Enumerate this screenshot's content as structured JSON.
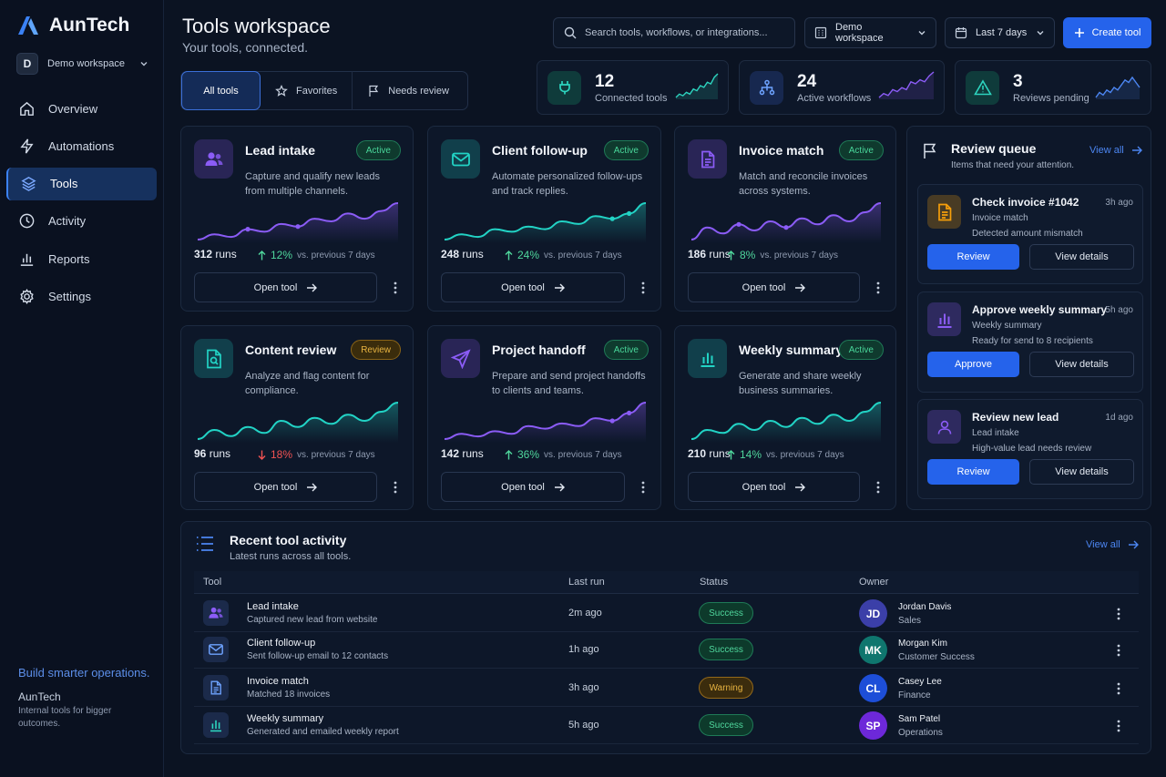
{
  "brand": {
    "name": "AunTech"
  },
  "workspace": {
    "initial": "D",
    "name": "Demo workspace"
  },
  "nav": [
    {
      "label": "Overview",
      "icon": "home-icon"
    },
    {
      "label": "Automations",
      "icon": "bolt-icon"
    },
    {
      "label": "Tools",
      "icon": "layers-icon",
      "active": true
    },
    {
      "label": "Activity",
      "icon": "clock-icon"
    },
    {
      "label": "Reports",
      "icon": "bar-chart-icon"
    },
    {
      "label": "Settings",
      "icon": "gear-icon"
    }
  ],
  "promo": {
    "title": "Build smarter operations.",
    "brand": "AunTech",
    "subtitle": "Internal tools for bigger outcomes."
  },
  "header": {
    "title": "Tools workspace",
    "subtitle": "Your tools, connected.",
    "search_placeholder": "Search tools, workflows, or integrations...",
    "workspace_select": "Demo workspace",
    "date_select": "Last 7 days",
    "create_label": "Create tool"
  },
  "filters": [
    {
      "label": "All tools",
      "active": true
    },
    {
      "label": "Favorites"
    },
    {
      "label": "Needs review"
    }
  ],
  "stats": [
    {
      "value": "12",
      "label": "Connected tools",
      "icon": "plug-icon",
      "trend": [
        4,
        6,
        5,
        7,
        6,
        9,
        8,
        11,
        10,
        13,
        12,
        16,
        18
      ]
    },
    {
      "value": "24",
      "label": "Active workflows",
      "icon": "workflow-icon",
      "trend": [
        5,
        7,
        6,
        9,
        8,
        10,
        9,
        13,
        12,
        14,
        13,
        16,
        18
      ]
    },
    {
      "value": "3",
      "label": "Reviews pending",
      "icon": "warning-icon",
      "trend": [
        6,
        8,
        7,
        9,
        8,
        10,
        9,
        11,
        13,
        12,
        14,
        12,
        10
      ]
    }
  ],
  "tools": [
    {
      "title": "Lead intake",
      "status": "Active",
      "status_type": "active",
      "desc": "Capture and qualify new leads from multiple channels.",
      "runs": "312",
      "runs_label": "runs",
      "delta": "12%",
      "dir": "up",
      "vs": "vs. previous 7 days",
      "open": "Open tool",
      "icon": "users-icon",
      "accent": "#8b5cf6",
      "trend": [
        3,
        4,
        3.5,
        5,
        4.5,
        6,
        5.5,
        7,
        6.5,
        8,
        7,
        8.5,
        10
      ]
    },
    {
      "title": "Client follow-up",
      "status": "Active",
      "status_type": "active",
      "desc": "Automate personalized follow-ups and track replies.",
      "runs": "248",
      "runs_label": "runs",
      "delta": "24%",
      "dir": "up",
      "vs": "vs. previous 7 days",
      "open": "Open tool",
      "icon": "mail-icon",
      "accent": "#22d3c5",
      "trend": [
        2,
        3,
        2.5,
        4,
        3.5,
        4.5,
        4,
        5.5,
        5,
        6.5,
        6,
        7,
        9
      ]
    },
    {
      "title": "Invoice match",
      "status": "Active",
      "status_type": "active",
      "desc": "Match and reconcile invoices across systems.",
      "runs": "186",
      "runs_label": "runs",
      "delta": "8%",
      "dir": "up",
      "vs": "vs. previous 7 days",
      "open": "Open tool",
      "icon": "document-icon",
      "accent": "#8b5cf6",
      "trend": [
        3,
        5,
        4,
        5.5,
        4.5,
        6,
        5,
        6.5,
        5.5,
        7,
        6,
        7.5,
        9
      ]
    },
    {
      "title": "Content review",
      "status": "Review",
      "status_type": "review",
      "desc": "Analyze and flag content for compliance.",
      "runs": "96",
      "runs_label": "runs",
      "delta": "18%",
      "dir": "down",
      "vs": "vs. previous 7 days",
      "open": "Open tool",
      "icon": "file-search-icon",
      "accent": "#22d3c5",
      "trend": [
        3,
        4.5,
        3.5,
        5,
        4,
        6,
        5,
        6.5,
        5.5,
        7,
        6,
        7.5,
        9
      ]
    },
    {
      "title": "Project handoff",
      "status": "Active",
      "status_type": "active",
      "desc": "Prepare and send project handoffs to clients and teams.",
      "runs": "142",
      "runs_label": "runs",
      "delta": "36%",
      "dir": "up",
      "vs": "vs. previous 7 days",
      "open": "Open tool",
      "icon": "send-icon",
      "accent": "#8b5cf6",
      "trend": [
        2,
        3,
        2.5,
        3.5,
        3,
        4.5,
        4,
        5,
        4.5,
        6,
        5.5,
        7,
        9
      ]
    },
    {
      "title": "Weekly summary",
      "status": "Active",
      "status_type": "active",
      "desc": "Generate and share weekly business summaries.",
      "runs": "210",
      "runs_label": "runs",
      "delta": "14%",
      "dir": "up",
      "vs": "vs. previous 7 days",
      "open": "Open tool",
      "icon": "bar-chart-icon",
      "accent": "#22d3c5",
      "trend": [
        3,
        4.5,
        4,
        5.5,
        4.5,
        6,
        5,
        6.5,
        5.5,
        7,
        6,
        7.5,
        9
      ]
    }
  ],
  "review_queue": {
    "title": "Review queue",
    "subtitle": "Items that need your attention.",
    "view_all": "View all",
    "items": [
      {
        "title": "Check invoice #1042",
        "time": "3h ago",
        "category": "Invoice match",
        "detail": "Detected amount mismatch",
        "primary": "Review",
        "secondary": "View details",
        "icon": "document-icon",
        "tone": "#f59e0b"
      },
      {
        "title": "Approve weekly summary",
        "time": "5h ago",
        "category": "Weekly summary",
        "detail": "Ready for send to 8 recipients",
        "primary": "Approve",
        "secondary": "View details",
        "icon": "bar-chart-icon",
        "tone": "#8b5cf6"
      },
      {
        "title": "Review new lead",
        "time": "1d ago",
        "category": "Lead intake",
        "detail": "High-value lead needs review",
        "primary": "Review",
        "secondary": "View details",
        "icon": "user-icon",
        "tone": "#8b5cf6"
      }
    ]
  },
  "activity": {
    "title": "Recent tool activity",
    "subtitle": "Latest runs across all tools.",
    "view_all": "View all",
    "columns": {
      "tool": "Tool",
      "last_run": "Last run",
      "status": "Status",
      "owner": "Owner"
    },
    "rows": [
      {
        "tool": "Lead intake",
        "desc": "Captured new lead from website",
        "last": "2m ago",
        "status": "Success",
        "status_type": "success",
        "initials": "JD",
        "owner": "Jordan Davis",
        "role": "Sales",
        "icon": "users-icon",
        "avatar_color": "#3b3fa8"
      },
      {
        "tool": "Client follow-up",
        "desc": "Sent follow-up email to 12 contacts",
        "last": "1h ago",
        "status": "Success",
        "status_type": "success",
        "initials": "MK",
        "owner": "Morgan Kim",
        "role": "Customer Success",
        "icon": "mail-icon",
        "avatar_color": "#0f766e"
      },
      {
        "tool": "Invoice match",
        "desc": "Matched 18 invoices",
        "last": "3h ago",
        "status": "Warning",
        "status_type": "warning",
        "initials": "CL",
        "owner": "Casey Lee",
        "role": "Finance",
        "icon": "document-icon",
        "avatar_color": "#1d4ed8"
      },
      {
        "tool": "Weekly summary",
        "desc": "Generated and emailed weekly report",
        "last": "5h ago",
        "status": "Success",
        "status_type": "success",
        "initials": "SP",
        "owner": "Sam Patel",
        "role": "Operations",
        "icon": "bar-chart-icon",
        "avatar_color": "#6d28d9"
      }
    ]
  },
  "colors": {
    "accent": "#2563eb",
    "success": "#4fd69c",
    "warning": "#e8b441",
    "danger": "#f05252"
  }
}
